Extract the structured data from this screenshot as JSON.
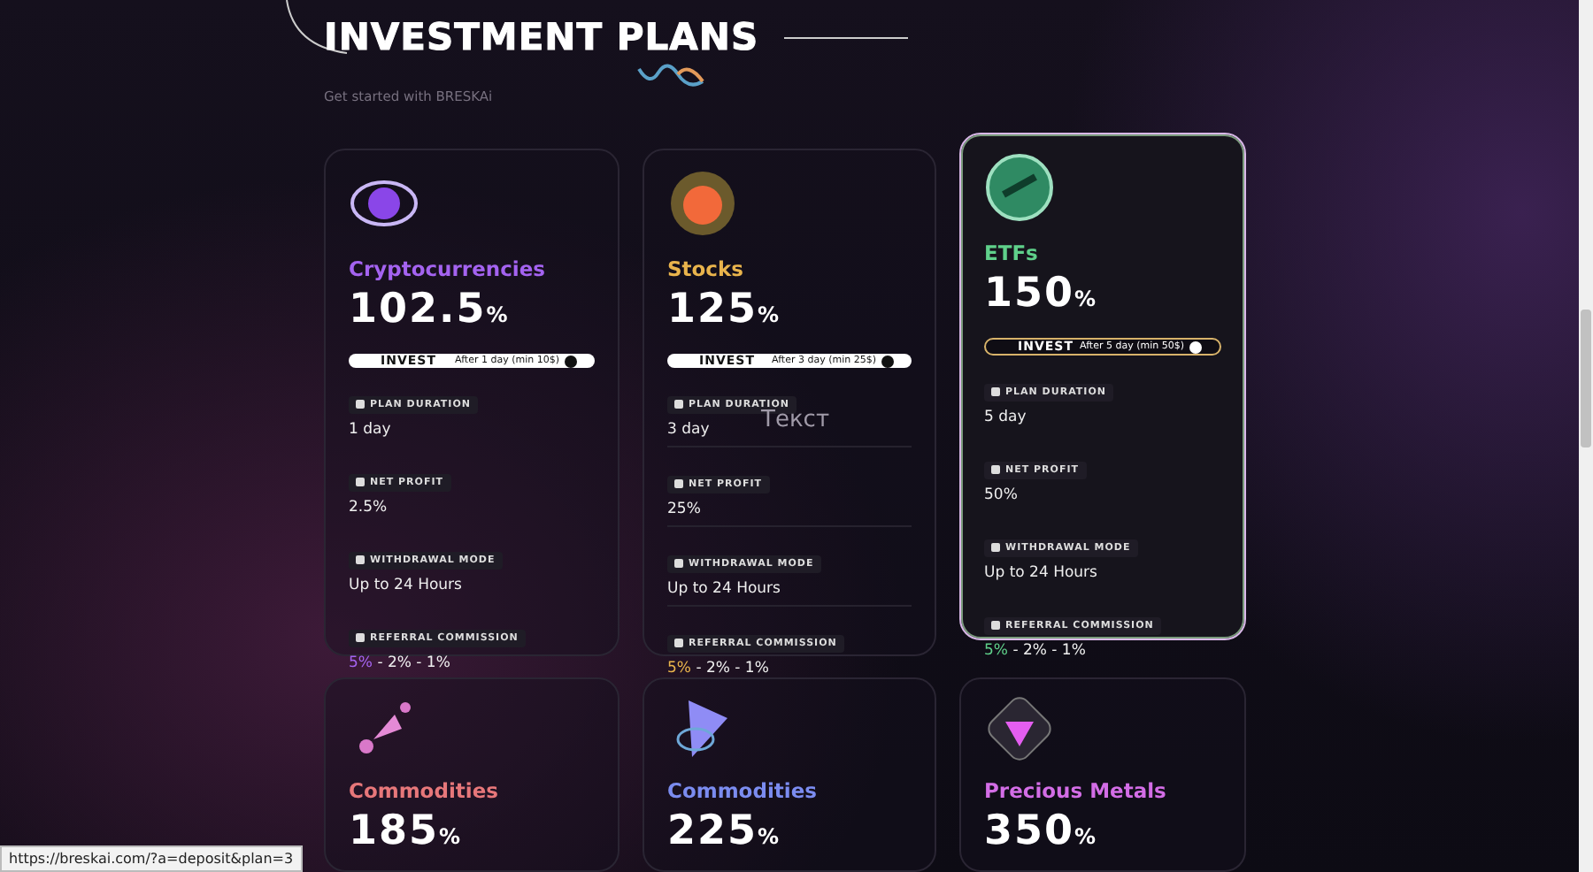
{
  "heading": {
    "title": "INVESTMENT PLANS",
    "subtitle": "Get started with BRESKAi"
  },
  "plans": [
    {
      "name": "Cryptocurrencies",
      "color": "#a463f0",
      "percent": "102.5",
      "unit": "%",
      "selected": false,
      "invest": {
        "label": "INVEST",
        "note": "After 1 day (min 10$)"
      },
      "details": [
        {
          "kind": "plain",
          "label": "PLAN DURATION",
          "value": "1 day"
        },
        {
          "kind": "plain",
          "label": "NET PROFIT",
          "value": "2.5%"
        },
        {
          "kind": "plain",
          "label": "WITHDRAWAL MODE",
          "value": "Up to 24 Hours"
        },
        {
          "kind": "referral",
          "label": "REFERRAL COMMISSION",
          "highlight": "5%",
          "value": "- 2% - 1%"
        }
      ]
    },
    {
      "name": "Stocks",
      "color": "#e9b44c",
      "percent": "125",
      "unit": "%",
      "selected": false,
      "invest": {
        "label": "INVEST",
        "note": "After 3 day (min 25$)"
      },
      "details": [
        {
          "kind": "plain",
          "label": "PLAN DURATION",
          "value": "3 day"
        },
        {
          "kind": "plain",
          "label": "NET PROFIT",
          "value": "25%"
        },
        {
          "kind": "plain",
          "label": "WITHDRAWAL MODE",
          "value": "Up to 24 Hours"
        },
        {
          "kind": "referral",
          "label": "REFERRAL COMMISSION",
          "highlight": "5%",
          "value": "- 2% - 1%"
        }
      ]
    },
    {
      "name": "ETFs",
      "color": "#5fd08a",
      "percent": "150",
      "unit": "%",
      "selected": true,
      "invest": {
        "label": "INVEST",
        "note": "After 5 day (min 50$)"
      },
      "details": [
        {
          "kind": "plain",
          "label": "PLAN DURATION",
          "value": "5 day"
        },
        {
          "kind": "plain",
          "label": "NET PROFIT",
          "value": "50%"
        },
        {
          "kind": "plain",
          "label": "WITHDRAWAL MODE",
          "value": "Up to 24 Hours"
        },
        {
          "kind": "referral",
          "label": "REFERRAL COMMISSION",
          "highlight": "5%",
          "value": "- 2% - 1%"
        }
      ]
    },
    {
      "name": "Commodities",
      "color": "#e7777a",
      "percent": "185",
      "unit": "%",
      "selected": false
    },
    {
      "name": "Commodities",
      "color": "#7b8cf0",
      "percent": "225",
      "unit": "%",
      "selected": false
    },
    {
      "name": "Precious Metals",
      "color": "#d36de6",
      "percent": "350",
      "unit": "%",
      "selected": false
    }
  ],
  "overlay_text": "Текст",
  "status_url": "https://breskai.com/?a=deposit&plan=3"
}
